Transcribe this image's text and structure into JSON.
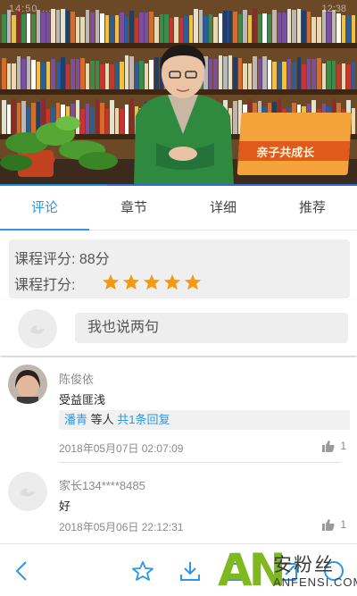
{
  "status_bar": {
    "left": "14:50 …",
    "right": "12:38"
  },
  "video": {
    "sign_text": "亲子共成长",
    "progress": 0.3
  },
  "tabs": [
    {
      "label": "评论",
      "active": true
    },
    {
      "label": "章节",
      "active": false
    },
    {
      "label": "详细",
      "active": false
    },
    {
      "label": "推荐",
      "active": false
    }
  ],
  "rating": {
    "score_label": "课程评分: 88分",
    "rate_label": "课程打分:",
    "stars": 5,
    "max_stars": 5,
    "star_color": "#f39a12"
  },
  "composer": {
    "placeholder": "我也说两句"
  },
  "comments": [
    {
      "name": "陈俊依",
      "text": "受益匪浅",
      "reply_user": "潘青",
      "reply_mid": "等人",
      "reply_count": "共1条回复",
      "date": "2018年05月07日 02:07:09",
      "likes": "1"
    },
    {
      "name": "家长134****8485",
      "text": "好",
      "date": "2018年05月06日 22:12:31",
      "likes": "1"
    }
  ],
  "watermark": {
    "big": "AN",
    "cn": "安粉丝",
    "en": "ANFENSI.COM"
  },
  "colors": {
    "accent": "#2d96e6",
    "star": "#f39a12",
    "watermark_green": "#7fb81f"
  },
  "icons": [
    "back-icon",
    "star-outline-icon",
    "download-icon",
    "share-icon",
    "edit-icon",
    "more-icon"
  ]
}
